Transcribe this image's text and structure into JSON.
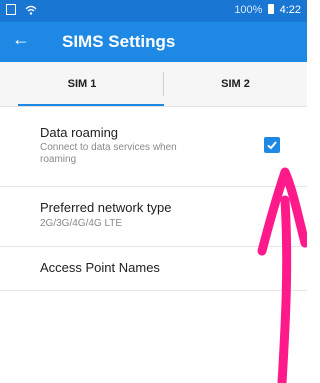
{
  "status": {
    "battery_text": "100%",
    "time": "4:22",
    "icons": [
      "sim-icon",
      "wifi-icon",
      "battery-icon"
    ]
  },
  "app_bar": {
    "title": "SIMS Settings",
    "back_icon": "back-arrow-icon"
  },
  "tabs": [
    {
      "label": "SIM 1",
      "selected": true
    },
    {
      "label": "SIM 2",
      "selected": false
    }
  ],
  "settings": {
    "data_roaming": {
      "title": "Data roaming",
      "subtitle_line1": "Connect to data services when",
      "subtitle_line2": "roaming",
      "checked": true
    },
    "network_type": {
      "title": "Preferred network type",
      "subtitle": "2G/3G/4G/4G LTE"
    },
    "apn": {
      "title": "Access Point Names"
    }
  },
  "colors": {
    "status_bar": "#1976d2",
    "app_bar": "#1e88e5",
    "accent": "#1e88e5",
    "annotation_arrow": "#ff1a8c"
  }
}
